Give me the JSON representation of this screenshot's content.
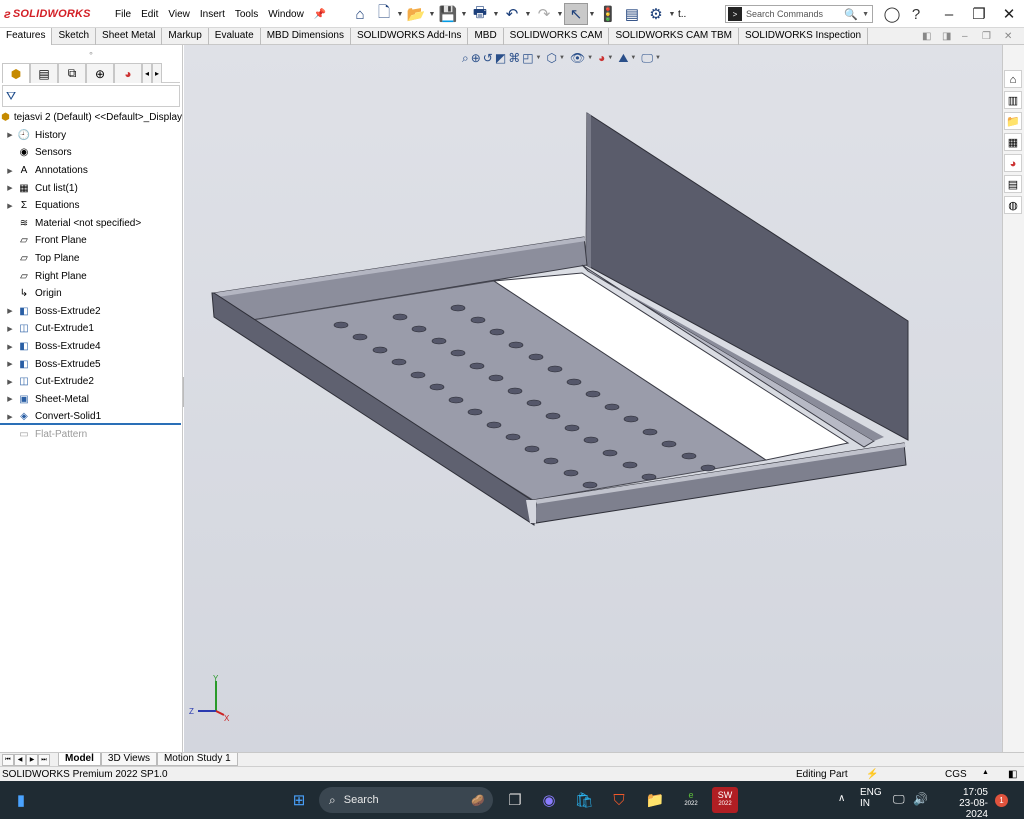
{
  "app": {
    "logo_text": "SOLIDWORKS",
    "menus": [
      "File",
      "Edit",
      "View",
      "Insert",
      "Tools",
      "Window"
    ],
    "toolbar_truncated_label": "t..",
    "search_placeholder": "Search Commands",
    "sq_icon": "command-prompt-icon"
  },
  "command_tabs": [
    "Features",
    "Sketch",
    "Sheet Metal",
    "Markup",
    "Evaluate",
    "MBD Dimensions",
    "SOLIDWORKS Add-Ins",
    "MBD",
    "SOLIDWORKS CAM",
    "SOLIDWORKS CAM TBM",
    "SOLIDWORKS Inspection"
  ],
  "feature_tree": {
    "root": "tejasvi 2 (Default) <<Default>_Display",
    "items": [
      {
        "label": "History",
        "icon": "history-icon",
        "expandable": true
      },
      {
        "label": "Sensors",
        "icon": "sensors-icon",
        "expandable": false
      },
      {
        "label": "Annotations",
        "icon": "annotations-icon",
        "expandable": true
      },
      {
        "label": "Cut list(1)",
        "icon": "cut-list-icon",
        "expandable": true
      },
      {
        "label": "Equations",
        "icon": "equations-icon",
        "expandable": true
      },
      {
        "label": "Material <not specified>",
        "icon": "material-icon",
        "expandable": false
      },
      {
        "label": "Front Plane",
        "icon": "plane-icon",
        "expandable": false
      },
      {
        "label": "Top Plane",
        "icon": "plane-icon",
        "expandable": false
      },
      {
        "label": "Right Plane",
        "icon": "plane-icon",
        "expandable": false
      },
      {
        "label": "Origin",
        "icon": "origin-icon",
        "expandable": false
      },
      {
        "label": "Boss-Extrude2",
        "icon": "boss-extrude-icon",
        "expandable": true
      },
      {
        "label": "Cut-Extrude1",
        "icon": "cut-extrude-icon",
        "expandable": true
      },
      {
        "label": "Boss-Extrude4",
        "icon": "boss-extrude-icon",
        "expandable": true
      },
      {
        "label": "Boss-Extrude5",
        "icon": "boss-extrude-icon",
        "expandable": true
      },
      {
        "label": "Cut-Extrude2",
        "icon": "cut-extrude-icon",
        "expandable": true
      },
      {
        "label": "Sheet-Metal",
        "icon": "sheet-metal-icon",
        "expandable": true
      },
      {
        "label": "Convert-Solid1",
        "icon": "convert-solid-icon",
        "expandable": true
      },
      {
        "label": "Flat-Pattern",
        "icon": "flat-pattern-icon",
        "expandable": false,
        "suppressed": true
      }
    ]
  },
  "triad": {
    "x": "X",
    "y": "Y",
    "z": "Z"
  },
  "bottom_tabs": [
    "Model",
    "3D Views",
    "Motion Study 1"
  ],
  "status_bar": {
    "product": "SOLIDWORKS Premium 2022 SP1.0",
    "mode": "Editing Part",
    "units": "CGS"
  },
  "taskbar": {
    "search_label": "Search",
    "lang_line1": "ENG",
    "lang_line2": "IN",
    "time": "17:05",
    "date": "23-08-2024",
    "notifications": "1",
    "year_badge": "2022"
  },
  "colors": {
    "viewport_bg": "#d8dbe2",
    "part_face": "#8a8c9c",
    "part_dark": "#5e6070",
    "brand_red": "#d31f26",
    "rollback_bar": "#2a6fb7"
  }
}
